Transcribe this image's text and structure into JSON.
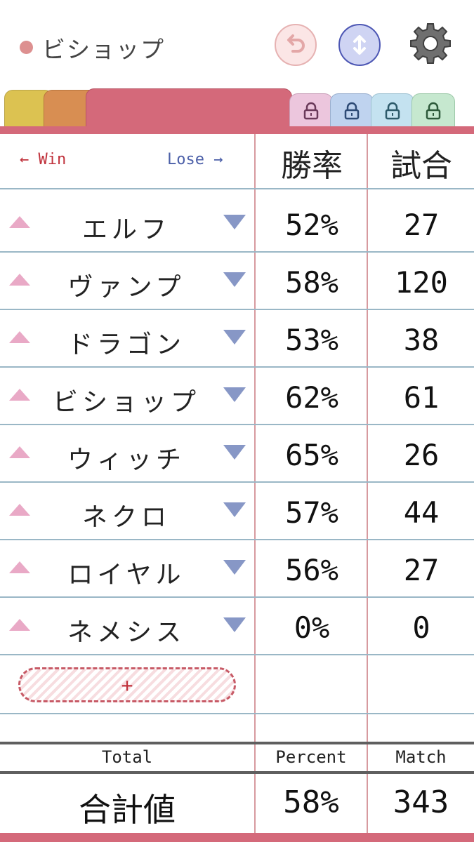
{
  "header": {
    "title": "ビショップ",
    "title_dot_color": "#dd9090",
    "undo_icon": "undo-icon",
    "swap_icon": "swap-vertical-icon",
    "settings_icon": "gear-icon"
  },
  "tabs": [
    {
      "color": "#dcc251",
      "locked": false
    },
    {
      "color": "#d88e52",
      "locked": false
    },
    {
      "color": "#d4697a",
      "locked": false,
      "active": true
    },
    {
      "color": "#ecc6dd",
      "locked": true
    },
    {
      "color": "#bfd3ef",
      "locked": true
    },
    {
      "color": "#c4e2f0",
      "locked": true
    },
    {
      "color": "#c6e8cf",
      "locked": true
    }
  ],
  "table": {
    "win_label": "← Win",
    "lose_label": "Lose →",
    "col_rate": "勝率",
    "col_games": "試合",
    "rows": [
      {
        "name": "エルフ",
        "rate": "52%",
        "games": "27"
      },
      {
        "name": "ヴァンプ",
        "rate": "58%",
        "games": "120"
      },
      {
        "name": "ドラゴン",
        "rate": "53%",
        "games": "38"
      },
      {
        "name": "ビショップ",
        "rate": "62%",
        "games": "61"
      },
      {
        "name": "ウィッチ",
        "rate": "65%",
        "games": "26"
      },
      {
        "name": "ネクロ",
        "rate": "57%",
        "games": "44"
      },
      {
        "name": "ロイヤル",
        "rate": "56%",
        "games": "27"
      },
      {
        "name": "ネメシス",
        "rate": "0%",
        "games": "0"
      }
    ],
    "add_label": "+"
  },
  "totals": {
    "total_label": "Total",
    "percent_label": "Percent",
    "match_label": "Match",
    "total_name": "合計値",
    "percent_value": "58%",
    "match_value": "343"
  }
}
